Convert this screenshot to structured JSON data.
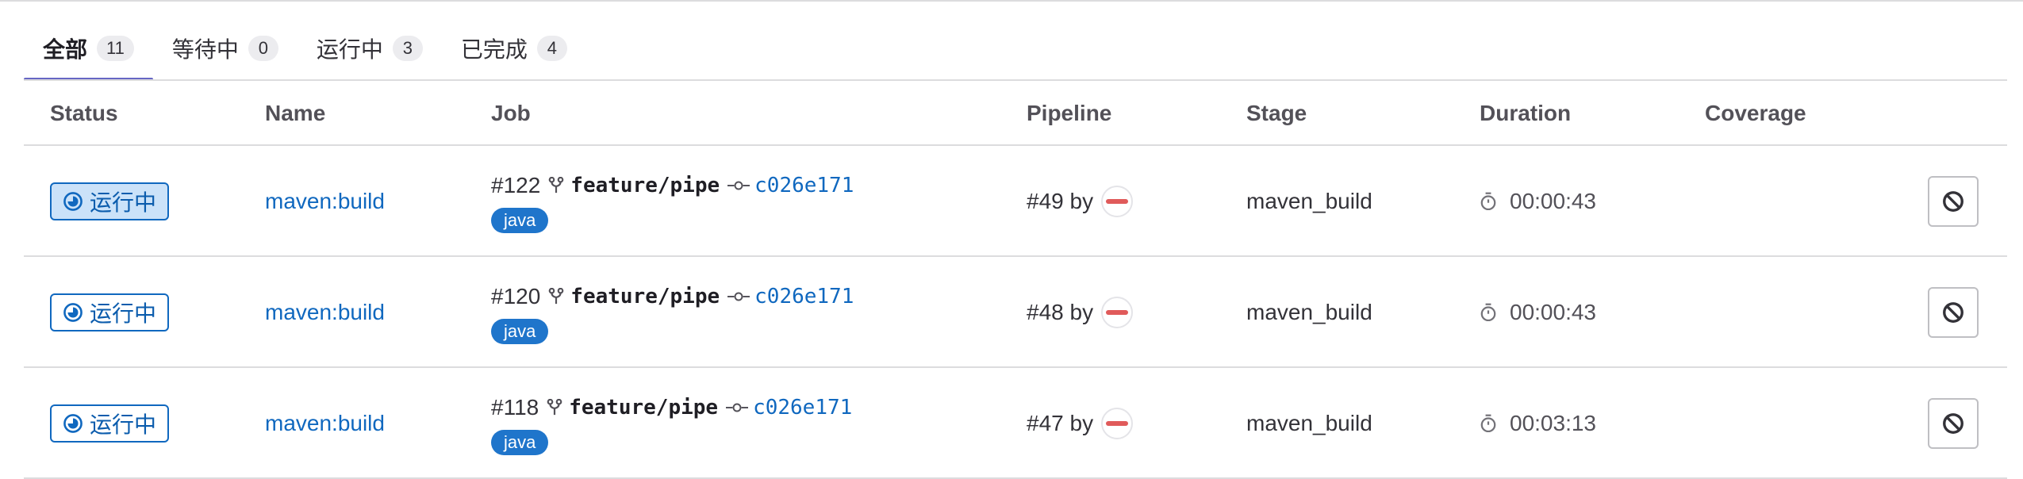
{
  "tabs": [
    {
      "label": "全部",
      "count": "11",
      "active": true
    },
    {
      "label": "等待中",
      "count": "0",
      "active": false
    },
    {
      "label": "运行中",
      "count": "3",
      "active": false
    },
    {
      "label": "已完成",
      "count": "4",
      "active": false
    }
  ],
  "columns": {
    "status": "Status",
    "name": "Name",
    "job": "Job",
    "pipeline": "Pipeline",
    "stage": "Stage",
    "duration": "Duration",
    "coverage": "Coverage"
  },
  "rows": [
    {
      "status": "运行中",
      "name": "maven:build",
      "job_id": "#122",
      "ref": "feature/pipe",
      "sha": "c026e171",
      "tag": "java",
      "pipeline": "#49 by",
      "stage": "maven_build",
      "duration": "00:00:43",
      "coverage": ""
    },
    {
      "status": "运行中",
      "name": "maven:build",
      "job_id": "#120",
      "ref": "feature/pipe",
      "sha": "c026e171",
      "tag": "java",
      "pipeline": "#48 by",
      "stage": "maven_build",
      "duration": "00:00:43",
      "coverage": ""
    },
    {
      "status": "运行中",
      "name": "maven:build",
      "job_id": "#118",
      "ref": "feature/pipe",
      "sha": "c026e171",
      "tag": "java",
      "pipeline": "#47 by",
      "stage": "maven_build",
      "duration": "00:03:13",
      "coverage": ""
    }
  ],
  "icons": {
    "status": "status-running-icon",
    "branch": "branch-icon",
    "commit": "commit-icon",
    "timer": "timer-icon",
    "cancel": "cancel-icon",
    "avatar": "user-avatar"
  },
  "colors": {
    "accent_tab": "#6666c4",
    "link": "#1068bf",
    "running": "#1068bf",
    "tag_bg": "#1f75cb"
  }
}
